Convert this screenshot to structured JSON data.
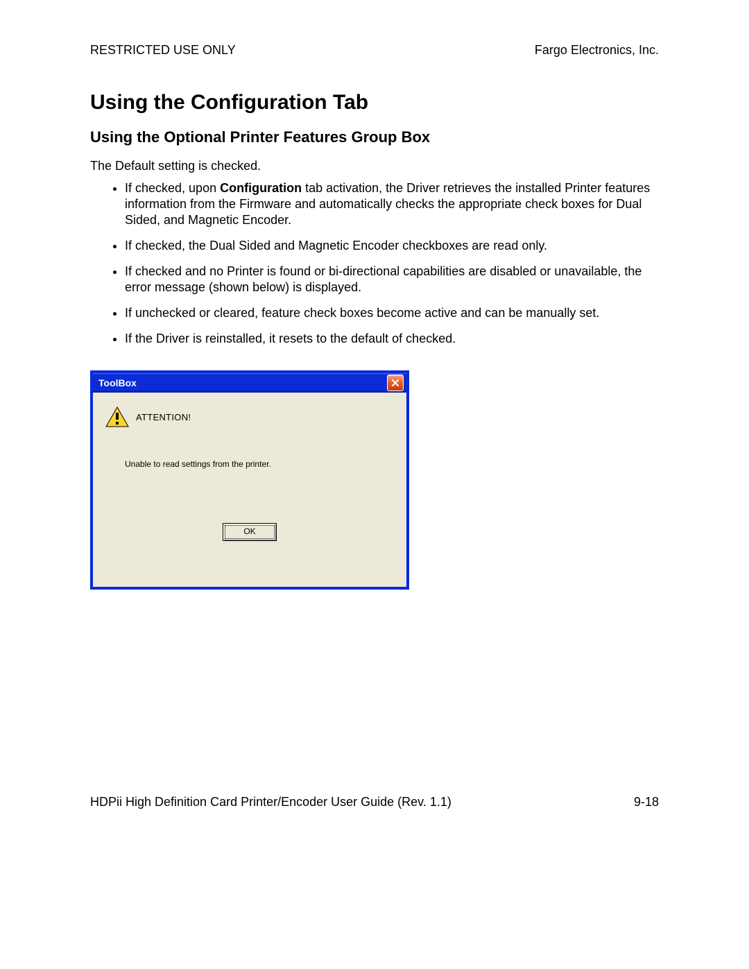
{
  "header": {
    "left": "RESTRICTED USE ONLY",
    "right": "Fargo Electronics, Inc."
  },
  "title": "Using the Configuration Tab",
  "subtitle": "Using the Optional Printer Features Group Box",
  "intro": "The Default setting is checked.",
  "bullets": [
    {
      "prefix": "If checked, upon ",
      "bold": "Configuration",
      "suffix": " tab activation, the Driver retrieves the installed Printer features information from the Firmware and automatically checks the appropriate check boxes for Dual Sided, and Magnetic Encoder."
    },
    {
      "text": "If checked, the Dual Sided and Magnetic Encoder checkboxes are read only."
    },
    {
      "text": "If checked and no Printer is found or bi-directional capabilities are disabled or unavailable, the error message (shown below) is displayed."
    },
    {
      "text": "If unchecked or cleared, feature check boxes become active and can be manually set."
    },
    {
      "text": "If the Driver is reinstalled, it resets to the default of checked."
    }
  ],
  "dialog": {
    "title": "ToolBox",
    "attention": "ATTENTION!",
    "message": "Unable to read settings from the printer.",
    "ok": "OK"
  },
  "footer": {
    "left": "HDPii High Definition Card Printer/Encoder User Guide (Rev. 1.1)",
    "right": "9-18"
  }
}
